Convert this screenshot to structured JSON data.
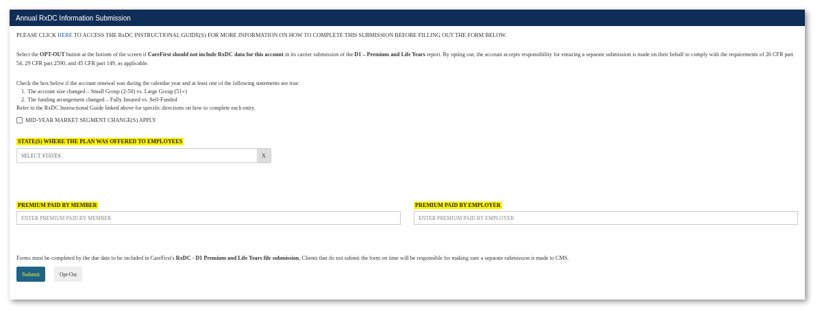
{
  "panel": {
    "title": "Annual RxDC Information Submission"
  },
  "intro": {
    "before": "PLEASE CLICK ",
    "link": "HERE",
    "after": " TO ACCESS THE RxDC INSTRUCTIONAL GUIDE(S) FOR MORE INFORMATION ON HOW TO COMPLETE THIS SUBMISSION BEFORE FILLING OUT THE FORM BELOW."
  },
  "opt_out_notice": "Select the **OPT-OUT** button at the bottom of the screen if **CareFirst should not include RxDC data for this account** in its carrier submission of the **D1 – Premium and Life Years** report. By opting out, the account accepts responsibility for ensuring a separate submission is made on their behalf to comply with the requirements of 26 CFR part 54, 29 CFR part 2590, and 45 CFR part 149, as applicable.",
  "check_intro": "Check the box below if the account renewal was during the calendar year and at least one of the following statements are true:",
  "statements": [
    "The account size changed – Small Group (2-50) vs. Large Group (51+)",
    "The funding arrangement changed – Fully Insured vs. Self-Funded"
  ],
  "statement_numbers": [
    "1.",
    "2."
  ],
  "refer_note": "Refer to the RxDC Instructional Guide linked above for specific directions on how to complete each entry.",
  "segment_change": {
    "label": "MID-YEAR MARKET SEGMENT CHANGE(S) APPLY",
    "checked": false
  },
  "states_field": {
    "label": "STATE(S) WHERE THE PLAN WAS OFFERED TO EMPLOYEES",
    "highlighted": true,
    "placeholder": "SELECT STATES",
    "clear": "X"
  },
  "premium_fields": [
    {
      "label": "PREMIUM PAID BY MEMBER",
      "highlighted": true,
      "placeholder": "ENTER PREMIUM PAID BY MEMBER"
    },
    {
      "label": "PREMIUM PAID BY EMPLOYER",
      "highlighted": true,
      "placeholder": "ENTER PREMIUM PAID BY EMPLOYER"
    }
  ],
  "footer_note": "Forms must be completed by the due date to be included in CareFirst's **RxDC - D1 Premium and Life Years file submission.** Clients that do not submit the form on time will be responsible for making sure a separate submission is made to CMS.",
  "buttons": [
    {
      "label": "Submit",
      "kind": "primary"
    },
    {
      "label": "Opt-Out",
      "kind": "secondary"
    }
  ]
}
